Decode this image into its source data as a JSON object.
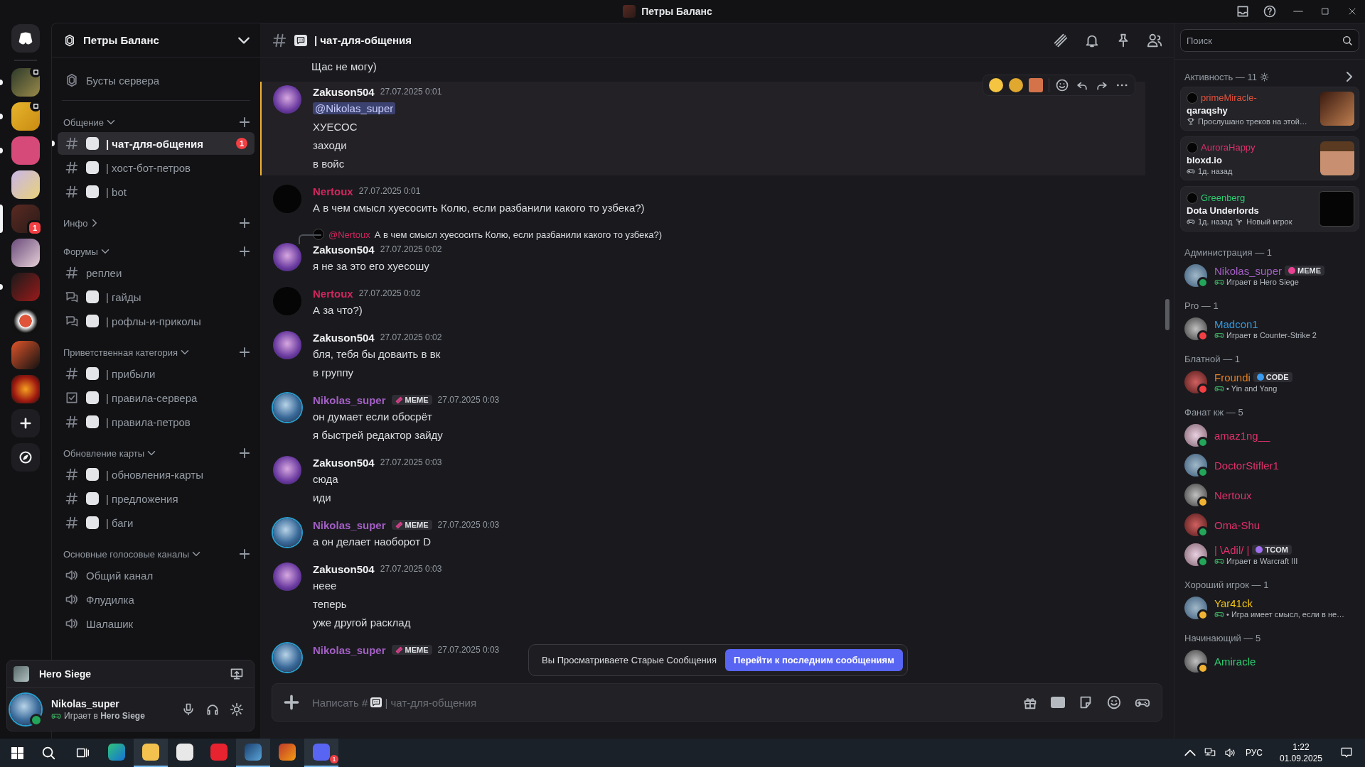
{
  "title_bar": {
    "title": "Петры Баланс"
  },
  "servers": [
    {
      "selected": false,
      "unread": true,
      "streaming": true
    },
    {
      "selected": false,
      "unread": true,
      "streaming": true
    },
    {
      "selected": false,
      "unread": true,
      "streaming": false
    },
    {
      "selected": false,
      "unread": false,
      "streaming": false
    },
    {
      "selected": true,
      "unread": false,
      "streaming": false,
      "badge": "1"
    },
    {
      "selected": false,
      "unread": false,
      "streaming": false
    },
    {
      "selected": false,
      "unread": true,
      "streaming": false
    },
    {
      "selected": false,
      "unread": false,
      "streaming": false
    },
    {
      "selected": false,
      "unread": false,
      "streaming": false
    },
    {
      "selected": false,
      "unread": false,
      "streaming": false
    }
  ],
  "sidebar": {
    "server_name": "Петры Баланс",
    "top_items": [
      {
        "kind": "boost",
        "name": "Бусты сервера"
      }
    ],
    "categories": [
      {
        "name": "Общение",
        "expanded": true,
        "channels": [
          {
            "kind": "text",
            "emoji": true,
            "name": "| чат-для-общения",
            "selected": true,
            "unread": true,
            "badge": "1"
          },
          {
            "kind": "text",
            "emoji": true,
            "name": "| хост-бот-петров",
            "selected": false,
            "unread": false
          },
          {
            "kind": "text",
            "emoji": true,
            "name": "| bot",
            "selected": false,
            "unread": false
          }
        ]
      },
      {
        "name": "Инфо",
        "expanded": false
      },
      {
        "name": "Форумы",
        "expanded": true,
        "channels": [
          {
            "kind": "text",
            "emoji": false,
            "name": "реплеи",
            "selected": false,
            "unread": false
          },
          {
            "kind": "forum",
            "emoji": true,
            "name": "| гайды",
            "selected": false,
            "unread": false
          },
          {
            "kind": "forum",
            "emoji": true,
            "name": "| рофлы-и-приколы",
            "selected": false,
            "unread": false
          }
        ]
      },
      {
        "name": "Приветственная категория",
        "expanded": true,
        "channels": [
          {
            "kind": "text",
            "emoji": true,
            "name": "| прибыли",
            "selected": false,
            "unread": false
          },
          {
            "kind": "rules",
            "emoji": true,
            "name": "| правила-сервера",
            "selected": false,
            "unread": false
          },
          {
            "kind": "text",
            "emoji": true,
            "name": "| правила-петров",
            "selected": false,
            "unread": false
          }
        ]
      },
      {
        "name": "Обновление карты",
        "expanded": true,
        "channels": [
          {
            "kind": "text",
            "emoji": true,
            "name": "| обновления-карты",
            "selected": false,
            "unread": false
          },
          {
            "kind": "text",
            "emoji": true,
            "name": "| предложения",
            "selected": false,
            "unread": false
          },
          {
            "kind": "text",
            "emoji": true,
            "name": "| баги",
            "selected": false,
            "unread": false
          }
        ]
      },
      {
        "name": "Основные голосовые каналы",
        "expanded": true,
        "channels": [
          {
            "kind": "voice",
            "emoji": false,
            "name": "Общий канал",
            "selected": false,
            "unread": false
          },
          {
            "kind": "voice",
            "emoji": false,
            "name": "Флудилка",
            "selected": false,
            "unread": false
          },
          {
            "kind": "voice",
            "emoji": false,
            "name": "Шалашик",
            "selected": false,
            "unread": false
          }
        ]
      }
    ]
  },
  "user_panel": {
    "game": "Hero Siege",
    "name": "Nikolas_super",
    "status": {
      "color": "#23a55a"
    },
    "activity": "Играет в **Hero Siege**"
  },
  "chat": {
    "channel": "| чат-для-общения",
    "messages": [
      {
        "kind": "continuation",
        "lines": [
          "Щас не могу)"
        ]
      },
      {
        "kind": "group",
        "author": "Zakuson504",
        "color": "#f2f3f5",
        "time": "27.07.2025 0:01",
        "mentioned": true,
        "mention": "@Nikolas_super",
        "lines": [
          "ХУЕСОС",
          "заходи",
          "в войс"
        ]
      },
      {
        "kind": "group",
        "author": "Nertoux",
        "color": "#d3265e",
        "time": "27.07.2025 0:01",
        "mentioned": false,
        "lines": [
          "А в чем смысл хуесосить Колю, если разбанили какого то узбека?)"
        ]
      },
      {
        "kind": "group",
        "author": "Zakuson504",
        "color": "#f2f3f5",
        "time": "27.07.2025 0:02",
        "mentioned": false,
        "reply": {
          "author": "@Nertoux",
          "color": "#d3265e",
          "text": "А в чем смысл хуесосить Колю, если разбанили какого то узбека?)"
        },
        "lines": [
          "я не за это его хуесошу"
        ]
      },
      {
        "kind": "group",
        "author": "Nertoux",
        "color": "#d3265e",
        "time": "27.07.2025 0:02",
        "mentioned": false,
        "lines": [
          "А за что?)"
        ]
      },
      {
        "kind": "group",
        "author": "Zakuson504",
        "color": "#f2f3f5",
        "time": "27.07.2025 0:02",
        "mentioned": false,
        "lines": [
          "бля, тебя бы доваить в вк",
          "в группу"
        ]
      },
      {
        "kind": "group",
        "author": "Nikolas_super",
        "color": "#a35fc4",
        "tag": "MEME",
        "time": "27.07.2025 0:03",
        "mentioned": false,
        "lines": [
          "он думает если обосрёт",
          "я быстрей редактор зайду"
        ]
      },
      {
        "kind": "group",
        "author": "Zakuson504",
        "color": "#f2f3f5",
        "time": "27.07.2025 0:03",
        "mentioned": false,
        "lines": [
          "сюда",
          "иди"
        ]
      },
      {
        "kind": "group",
        "author": "Nikolas_super",
        "color": "#a35fc4",
        "tag": "MEME",
        "time": "27.07.2025 0:03",
        "mentioned": false,
        "lines": [
          "а он делает наоборот D"
        ]
      },
      {
        "kind": "group",
        "author": "Zakuson504",
        "color": "#f2f3f5",
        "time": "27.07.2025 0:03",
        "mentioned": false,
        "lines": [
          "неее",
          "теперь",
          "уже другой расклад"
        ]
      },
      {
        "kind": "group",
        "author": "Nikolas_super",
        "color": "#a35fc4",
        "tag": "MEME",
        "time": "27.07.2025 0:03",
        "mentioned": false
      }
    ],
    "jump_bar": {
      "text": "Вы Просматриваете Старые Сообщения",
      "button": "Перейти к последним сообщениям"
    },
    "composer": {
      "placeholder": "Написать #",
      "channel": "| чат-для-общения"
    }
  },
  "members": {
    "search_placeholder": "Поиск",
    "activity_title": "Активность — 11",
    "cards": [
      {
        "user": "primeMiracle-",
        "color": "#e5533d",
        "title": "qaraqshy",
        "details": [
          {
            "kind": "trophy",
            "text": "Прослушано треков на этой…"
          }
        ]
      },
      {
        "user": "AuroraHappy",
        "color": "#e0306a",
        "title": "bloxd.io",
        "details": [
          {
            "kind": "game",
            "text": "1д. назад"
          }
        ]
      },
      {
        "user": "Greenberg",
        "color": "#2ecc71",
        "title": "Dota Underlords",
        "details": [
          {
            "kind": "game",
            "text": "1д. назад"
          },
          {
            "kind": "sprout",
            "text": "Новый игрок"
          }
        ]
      }
    ],
    "groups": [
      {
        "title": "Администрация — 1",
        "members": [
          {
            "name": "Nikolas_super",
            "color": "#a35fc4",
            "status": {
              "color": "#23a55a"
            },
            "tag": {
              "text": "MEME",
              "color": "#e84393"
            },
            "activity": "Играет в Hero Siege"
          }
        ]
      },
      {
        "title": "Pro — 1",
        "members": [
          {
            "name": "Madcon1",
            "color": "#3498db",
            "status": {
              "color": "#f23f43"
            },
            "activity": "Играет в Counter-Strike 2"
          }
        ]
      },
      {
        "title": "Блатной — 1",
        "members": [
          {
            "name": "Froundi",
            "color": "#e67e22",
            "status": {
              "color": "#f23f43"
            },
            "tag": {
              "text": "CODE",
              "color": "#3b9cf0"
            },
            "activity": "• Yin and Yang"
          }
        ]
      },
      {
        "title": "Фанат кж — 5",
        "members": [
          {
            "name": "amaz1ng__",
            "color": "#e0306a",
            "status": {
              "color": "#23a55a"
            }
          },
          {
            "name": "DoctorStifler1",
            "color": "#e0306a",
            "status": {
              "color": "#23a55a"
            }
          },
          {
            "name": "Nertoux",
            "color": "#e0306a",
            "status": {
              "color": "#f0b232"
            }
          },
          {
            "name": "Oma-Shu",
            "color": "#e0306a",
            "status": {
              "color": "#23a55a"
            }
          },
          {
            "name": "| \\Adil/ |",
            "color": "#e0306a",
            "status": {
              "color": "#23a55a"
            },
            "tag": {
              "text": "TCOM",
              "color": "#a070f0"
            },
            "activity": "Играет в Warcraft III"
          }
        ]
      },
      {
        "title": "Хороший игрок — 1",
        "members": [
          {
            "name": "Yar41ck",
            "color": "#f1c40f",
            "status": {
              "color": "#f0b232"
            },
            "activity": "• Игра имеет смысл, если в не…"
          }
        ]
      },
      {
        "title": "Начинающий — 5",
        "members": [
          {
            "name": "Amiracle",
            "color": "#2ecc71",
            "status": {
              "color": "#f0b232"
            }
          }
        ]
      }
    ]
  },
  "taskbar": {
    "apps": [
      {
        "kind": "browser",
        "active": false
      },
      {
        "kind": "folder",
        "active": true
      },
      {
        "kind": "store",
        "active": false
      },
      {
        "kind": "ring",
        "active": false
      },
      {
        "kind": "steam",
        "active": true
      },
      {
        "kind": "game",
        "active": false
      },
      {
        "kind": "chat",
        "active": true,
        "badge": "1"
      }
    ],
    "lang": "РУС",
    "time": "1:22",
    "date": "01.09.2025"
  }
}
